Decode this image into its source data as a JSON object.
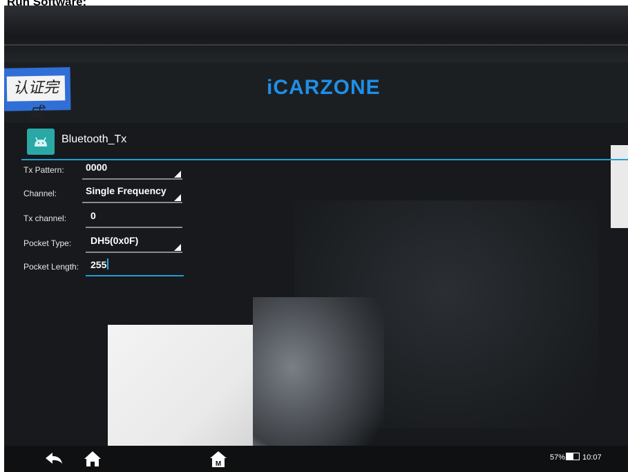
{
  "photo_title": "Run Software:",
  "header": {
    "sticker_text": "认证完成",
    "logo_text": "iCARZONE",
    "logo_color": "#1e8fe8"
  },
  "app": {
    "title": "Bluetooth_Tx",
    "accent_color": "#1ea0d7"
  },
  "form": {
    "tx_pattern": {
      "label": "Tx Pattern:",
      "value": "0000"
    },
    "channel": {
      "label": "Channel:",
      "value": "Single Frequency"
    },
    "tx_channel": {
      "label": "Tx channel:",
      "value": "0"
    },
    "pocket_type": {
      "label": "Pocket Type:",
      "value": "DH5(0x0F)"
    },
    "pocket_length": {
      "label": "Pocket Length:",
      "value": "255"
    }
  },
  "nav": {
    "back_icon": "back-arrow-icon",
    "home_icon": "home-icon",
    "menu_icon": "menu-house-icon"
  },
  "status": {
    "battery_percent": "57%",
    "battery_level": 0.57,
    "time": "10:07"
  }
}
